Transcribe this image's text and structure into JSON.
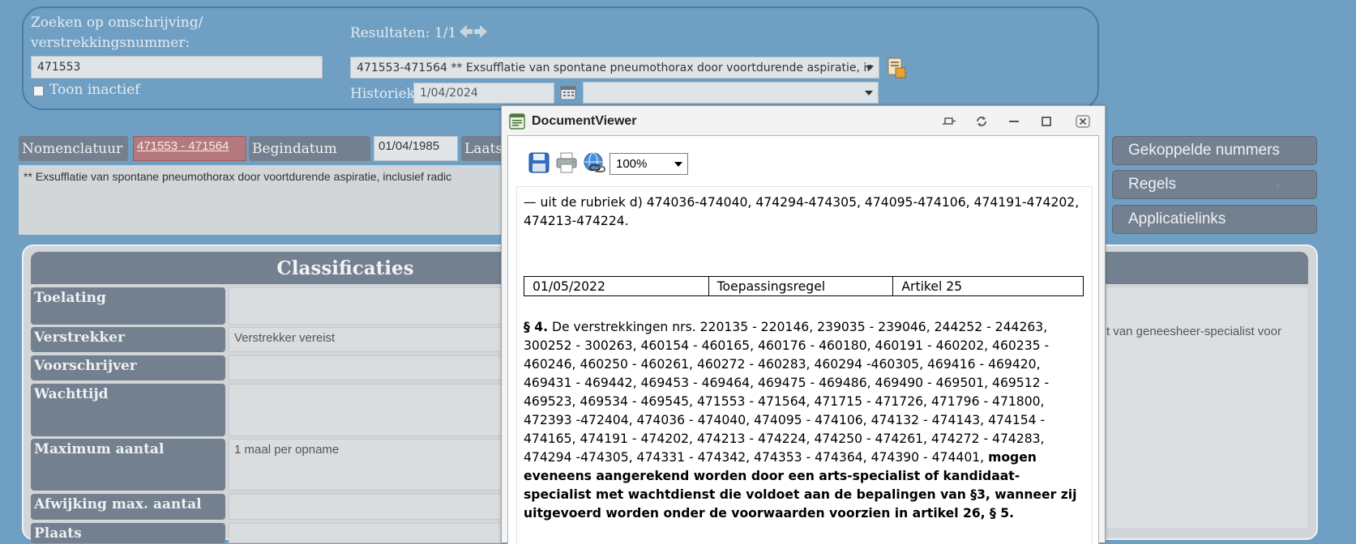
{
  "search": {
    "label": "Zoeken op omschrijving/ verstrekkingsnummer:",
    "value": "471553",
    "show_inactive_label": "Toon inactief",
    "show_inactive_checked": false,
    "results_label": "Resultaten: 1/1",
    "result_selected": "471553-471564 ** Exsufflatie van spontane pneumothorax door voortdurende aspiratie, ir",
    "history_label": "Historiek",
    "history_date": "1/04/2024",
    "history_select": ""
  },
  "nomenclature": {
    "nomen_label": "Nomenclatuur",
    "nomen_value": "471553 - 471564",
    "begin_label": "Begindatum",
    "begin_value": "01/04/1985",
    "last_label": "Laats",
    "description": "** Exsufflatie van spontane pneumothorax door voortdurende aspiratie, inclusief radic"
  },
  "classifications": {
    "title": "Classificaties",
    "rows": [
      {
        "label": "Toelating",
        "value": ""
      },
      {
        "label": "Verstrekker",
        "value": "Verstrekker vereist"
      },
      {
        "label": "Voorschrijver",
        "value": ""
      },
      {
        "label": "Wachttijd",
        "value": ""
      },
      {
        "label": "Maximum aantal",
        "value": "1 maal per opname"
      },
      {
        "label": "Afwijking max. aantal",
        "value": ""
      },
      {
        "label": "Plaats",
        "value": ""
      }
    ],
    "right_text": "t van geneesheer-specialist voor"
  },
  "side_buttons": {
    "linked": "Gekoppelde nummers",
    "rules": "Regels",
    "rules_arrow": "›",
    "applinks": "Applicatielinks"
  },
  "viewer": {
    "title": "DocumentViewer",
    "zoom": "100%",
    "intro_line": "— uit de rubriek d) 474036-474040, 474294-474305, 474095-474106, 474191-474202, 474213-474224.",
    "table": {
      "date": "01/05/2022",
      "type": "Toepassingsregel",
      "article": "Artikel 25"
    },
    "para_heading": "§ 4.",
    "para_body": "De verstrekkingen nrs. 220135 - 220146, 239035 - 239046, 244252 - 244263, 300252 - 300263, 460154 - 460165, 460176 - 460180, 460191 - 460202, 460235 - 460246, 460250 - 460261, 460272 - 460283, 460294 -460305, 469416 - 469420, 469431 - 469442, 469453 - 469464, 469475 - 469486, 469490 - 469501, 469512 - 469523, 469534 - 469545, 471553 - 471564, 471715 - 471726, 471796 - 471800, 472393 -472404, 474036 - 474040, 474095 - 474106, 474132 - 474143, 474154 - 474165, 474191 - 474202, 474213 - 474224, 474250 - 474261, 474272 - 474283, 474294 -474305, 474331 - 474342, 474353 - 474364, 474390 - 474401,",
    "para_bold": "mogen eveneens aangerekend worden door een arts-specialist of kandidaat-specialist met wachtdienst die voldoet aan de bepalingen van §3, wanneer zij uitgevoerd worden onder de voorwaarden voorzien in artikel 26, § 5."
  },
  "colors": {
    "background": "#6fa0c4",
    "label_bg": "#73808f",
    "nomen_value_bg": "#b4797c"
  }
}
